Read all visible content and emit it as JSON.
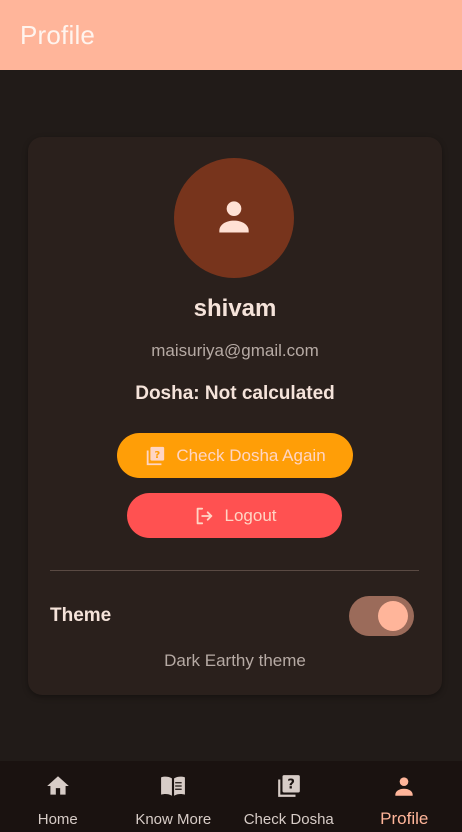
{
  "app_bar": {
    "title": "Profile"
  },
  "profile": {
    "name": "shivam",
    "email": "maisuriya@gmail.com",
    "dosha_status": "Dosha: Not calculated",
    "avatar_icon": "person-icon"
  },
  "actions": {
    "check_dosha_label": "Check Dosha Again",
    "logout_label": "Logout"
  },
  "theme": {
    "label": "Theme",
    "toggle_on": true,
    "current": "Dark Earthy theme"
  },
  "bottom_nav": {
    "items": [
      {
        "label": "Home",
        "icon": "home-icon",
        "active": false
      },
      {
        "label": "Know More",
        "icon": "book-icon",
        "active": false
      },
      {
        "label": "Check Dosha",
        "icon": "quiz-icon",
        "active": false
      },
      {
        "label": "Profile",
        "icon": "person-icon",
        "active": true
      }
    ]
  },
  "colors": {
    "accent": "#ffb59a",
    "background": "#211b18",
    "card": "#2a201c",
    "check_button": "#ff9e07",
    "logout_button": "#ff5151",
    "avatar": "#77341c"
  }
}
